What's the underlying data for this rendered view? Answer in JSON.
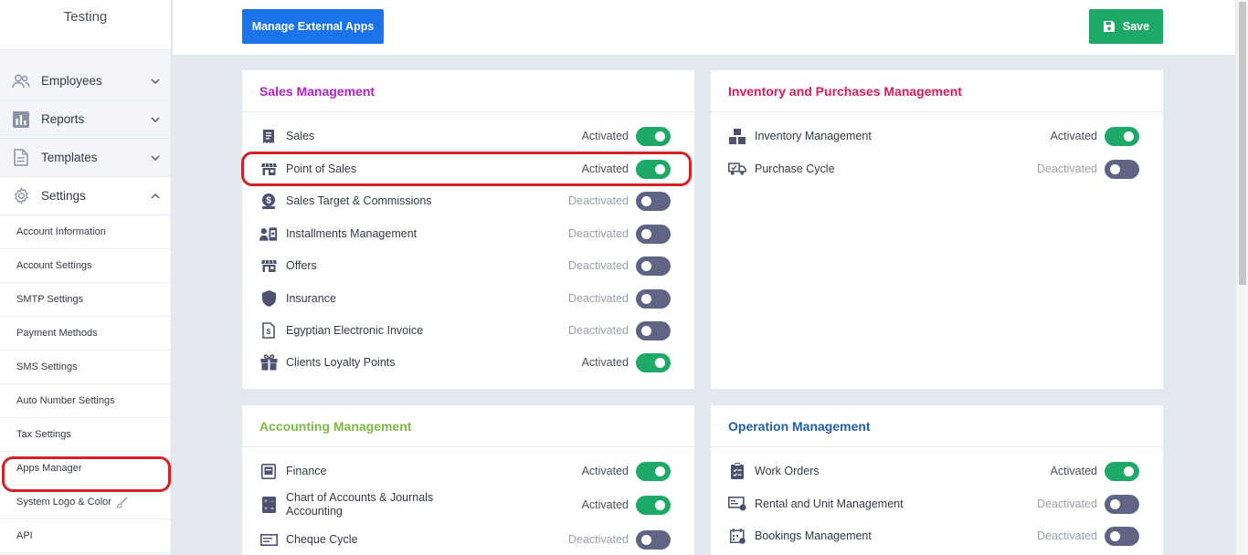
{
  "sidebar": {
    "company_name": "Testing",
    "nav": [
      {
        "label": "Employees",
        "icon": "users-icon"
      },
      {
        "label": "Reports",
        "icon": "bar-chart-icon"
      },
      {
        "label": "Templates",
        "icon": "document-icon"
      },
      {
        "label": "Settings",
        "icon": "gear-icon"
      }
    ],
    "settings_items": [
      "Account Information",
      "Account Settings",
      "SMTP Settings",
      "Payment Methods",
      "SMS Settings",
      "Auto Number Settings",
      "Tax Settings",
      "Apps Manager",
      "System Logo & Color",
      "API"
    ]
  },
  "toolbar": {
    "manage_external_label": "Manage External Apps",
    "save_label": "Save"
  },
  "colors": {
    "primary": "#1a73e8",
    "success": "#1fa968",
    "toggle_off": "#5f6484",
    "highlight": "#d71f26",
    "sales_title": "#b021c9",
    "inventory_title": "#d61c5a",
    "accounting_title": "#7cb944",
    "operation_title": "#1e5fa8"
  },
  "sections": {
    "sales": {
      "title": "Sales Management",
      "apps": [
        {
          "label": "Sales",
          "status": "Activated",
          "icon": "receipt-icon"
        },
        {
          "label": "Point of Sales",
          "status": "Activated",
          "icon": "store-icon"
        },
        {
          "label": "Sales Target & Commissions",
          "status": "Deactivated",
          "icon": "money-target-icon"
        },
        {
          "label": "Installments Management",
          "status": "Deactivated",
          "icon": "installments-icon"
        },
        {
          "label": "Offers",
          "status": "Deactivated",
          "icon": "store-icon"
        },
        {
          "label": "Insurance",
          "status": "Deactivated",
          "icon": "shield-icon"
        },
        {
          "label": "Egyptian Electronic Invoice",
          "status": "Deactivated",
          "icon": "invoice-icon"
        },
        {
          "label": "Clients Loyalty Points",
          "status": "Activated",
          "icon": "gift-icon"
        }
      ]
    },
    "inventory": {
      "title": "Inventory and Purchases Management",
      "apps": [
        {
          "label": "Inventory Management",
          "status": "Activated",
          "icon": "boxes-icon"
        },
        {
          "label": "Purchase Cycle",
          "status": "Deactivated",
          "icon": "truck-icon"
        }
      ]
    },
    "accounting": {
      "title": "Accounting Management",
      "apps": [
        {
          "label": "Finance",
          "status": "Activated",
          "icon": "safe-icon"
        },
        {
          "label": "Chart of Accounts & Journals Accounting",
          "status": "Activated",
          "icon": "calculator-icon"
        },
        {
          "label": "Cheque Cycle",
          "status": "Deactivated",
          "icon": "cheque-icon"
        }
      ]
    },
    "operation": {
      "title": "Operation Management",
      "apps": [
        {
          "label": "Work Orders",
          "status": "Activated",
          "icon": "clipboard-icon"
        },
        {
          "label": "Rental and Unit Management",
          "status": "Deactivated",
          "icon": "rental-icon"
        },
        {
          "label": "Bookings Management",
          "status": "Deactivated",
          "icon": "calendar-icon"
        }
      ]
    }
  }
}
